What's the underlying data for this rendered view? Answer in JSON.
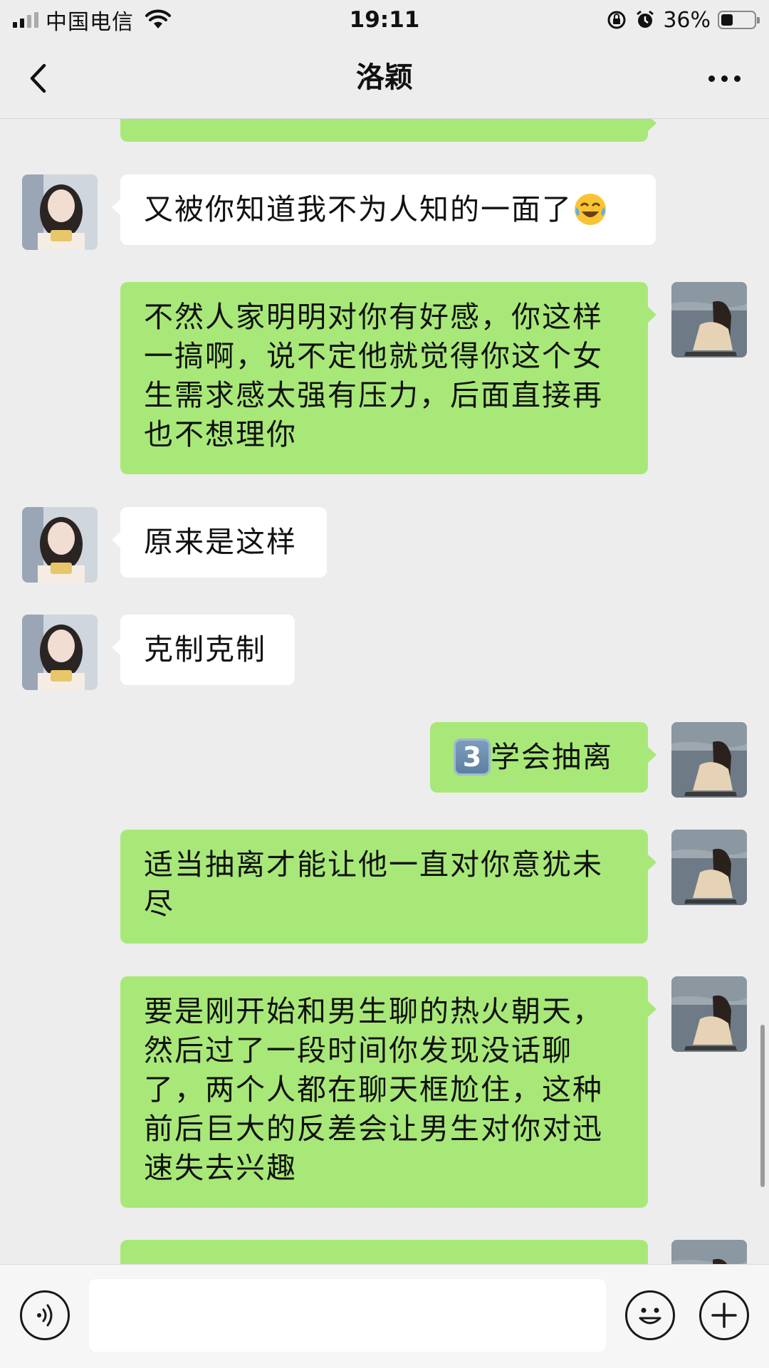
{
  "status_bar": {
    "carrier": "中国电信",
    "time": "19:11",
    "battery_percent": "36%",
    "battery_level": 0.36
  },
  "nav": {
    "title": "洛颖"
  },
  "messages": [
    {
      "direction": "out",
      "text": ""
    },
    {
      "direction": "in",
      "text": "又被你知道我不为人知的一面了",
      "emoji": "crying-laughing"
    },
    {
      "direction": "out",
      "text": "不然人家明明对你有好感，你这样一搞啊，说不定他就觉得你这个女生需求感太强有压力，后面直接再也不想理你"
    },
    {
      "direction": "in",
      "text": "原来是这样"
    },
    {
      "direction": "in",
      "text": "克制克制"
    },
    {
      "direction": "out",
      "number_key": "3",
      "text": "学会抽离"
    },
    {
      "direction": "out",
      "text": "适当抽离才能让他一直对你意犹未尽"
    },
    {
      "direction": "out",
      "text": "要是刚开始和男生聊的热火朝天，然后过了一段时间你发现没话聊了，两个人都在聊天框尬住，这种前后巨大的反差会让男生对你对迅速失去兴趣"
    },
    {
      "direction": "out",
      "text": ""
    }
  ],
  "input": {
    "value": "",
    "placeholder": ""
  },
  "icons": {
    "back": "chevron-left-icon",
    "more": "more-dots-icon",
    "voice": "voice-icon",
    "emoji": "emoji-icon",
    "plus": "plus-icon"
  },
  "colors": {
    "background": "#ededed",
    "outgoing_bubble": "#a8e878",
    "incoming_bubble": "#ffffff"
  }
}
